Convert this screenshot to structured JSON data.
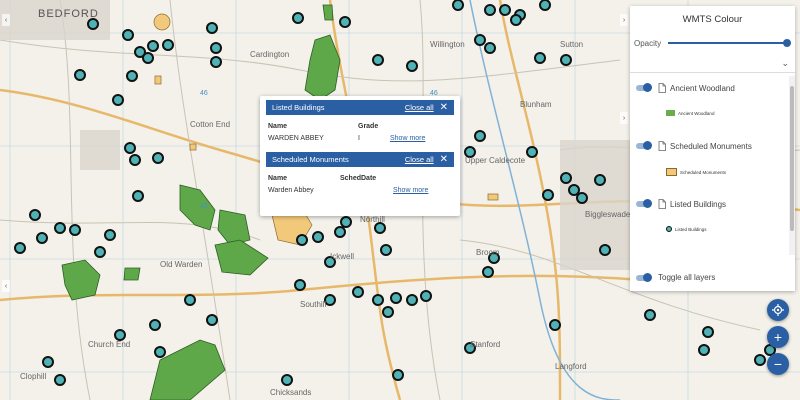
{
  "map": {
    "place_labels": [
      {
        "text": "BEDFORD",
        "cls": "big"
      },
      {
        "text": "Willington"
      },
      {
        "text": "Old Warden"
      },
      {
        "text": "Northill"
      },
      {
        "text": "Ickwell"
      },
      {
        "text": "Upper Caldecote"
      },
      {
        "text": "Biggleswade"
      },
      {
        "text": "Southill"
      },
      {
        "text": "Stanford"
      },
      {
        "text": "Chicksands"
      },
      {
        "text": "Church End"
      },
      {
        "text": "Sutton"
      },
      {
        "text": "Broom"
      },
      {
        "text": "Langford"
      },
      {
        "text": "Clophill"
      },
      {
        "text": "Cardington"
      },
      {
        "text": "Cotton End"
      },
      {
        "text": "Blunham"
      }
    ]
  },
  "popup": {
    "sections": [
      {
        "title": "Listed Buildings",
        "close_label": "Close all",
        "col1": "Name",
        "col2": "Grade",
        "value1": "WARDEN ABBEY",
        "value2": "I",
        "more": "Show more"
      },
      {
        "title": "Scheduled Monuments",
        "close_label": "Close all",
        "col1": "Name",
        "col2": "SchedDate",
        "value1": "Warden Abbey",
        "value2": "",
        "more": "Show more"
      }
    ]
  },
  "panel": {
    "title": "WMTS Colour",
    "opacity_label": "Opacity",
    "opacity_value": 1.0,
    "layers": [
      {
        "name": "Ancient Woodland",
        "legend": "Ancient Woodland",
        "color": "#6aad4f",
        "kind": "swatch"
      },
      {
        "name": "Scheduled Monuments",
        "legend": "Scheduled Monuments",
        "color": "#f2c97a",
        "kind": "swatch"
      },
      {
        "name": "Listed Buildings",
        "legend": "Listed Buildings",
        "color": "#4fb3b6",
        "kind": "dot"
      }
    ],
    "toggle_all_label": "Toggle all layers"
  },
  "controls": {
    "locate_icon": "crosshair-icon",
    "zoom_in": "+",
    "zoom_out": "−"
  },
  "colors": {
    "accent": "#2b5fa3",
    "woodland": "#5fa84a",
    "monument": "#f2c97a",
    "listed": "#4fb3b6"
  }
}
